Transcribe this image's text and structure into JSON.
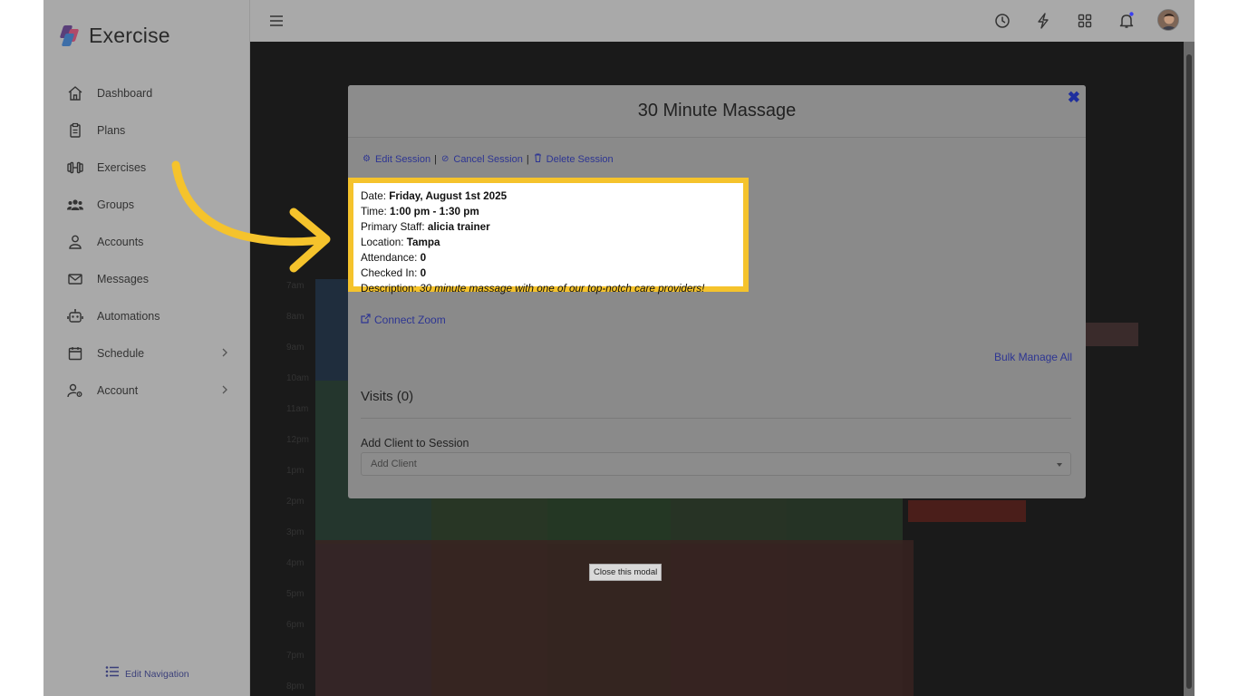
{
  "app": {
    "name": "Exercise"
  },
  "sidebar": {
    "items": [
      {
        "label": "Dashboard",
        "icon": "home-icon"
      },
      {
        "label": "Plans",
        "icon": "clipboard-icon"
      },
      {
        "label": "Exercises",
        "icon": "dumbbell-icon"
      },
      {
        "label": "Groups",
        "icon": "users-icon"
      },
      {
        "label": "Accounts",
        "icon": "user-icon"
      },
      {
        "label": "Messages",
        "icon": "envelope-icon"
      },
      {
        "label": "Automations",
        "icon": "robot-icon"
      },
      {
        "label": "Schedule",
        "icon": "calendar-icon",
        "has_submenu": true
      },
      {
        "label": "Account",
        "icon": "user-gear-icon",
        "has_submenu": true
      }
    ],
    "edit_navigation": "Edit Navigation"
  },
  "topbar": {
    "icons": [
      "menu-icon",
      "clock-icon",
      "bolt-icon",
      "grid-icon",
      "bell-icon",
      "avatar"
    ],
    "notification_dot_color": "#3b3ff0"
  },
  "calendar": {
    "hours": [
      "7am",
      "8am",
      "9am",
      "10am",
      "11am",
      "12pm",
      "1pm",
      "2pm",
      "3pm",
      "4pm",
      "5pm",
      "6pm",
      "7pm",
      "8pm"
    ]
  },
  "modal": {
    "title": "30 Minute Massage",
    "actions": [
      {
        "label": "Edit Session",
        "icon": "gear-icon"
      },
      {
        "label": "Cancel Session",
        "icon": "ban-icon"
      },
      {
        "label": "Delete Session",
        "icon": "trash-icon"
      }
    ],
    "details": {
      "date_label": "Date:",
      "date": "Friday, August 1st 2025",
      "time_label": "Time:",
      "time": "1:00 pm - 1:30 pm",
      "staff_label": "Primary Staff:",
      "staff": "alicia trainer",
      "location_label": "Location:",
      "location": "Tampa",
      "attendance_label": "Attendance:",
      "attendance": "0",
      "checked_in_label": "Checked In:",
      "checked_in": "0",
      "description_label": "Description:",
      "description": "30 minute massage with one of our top-notch care providers!"
    },
    "connect_zoom": "Connect Zoom",
    "bulk_manage": "Bulk Manage All",
    "visits_heading": "Visits (0)",
    "add_client_label": "Add Client to Session",
    "add_client_placeholder": "Add Client"
  },
  "tooltip": "Close this modal",
  "colors": {
    "highlight": "#f5c32c",
    "link": "#2d3593",
    "close": "#1f2f9e"
  }
}
